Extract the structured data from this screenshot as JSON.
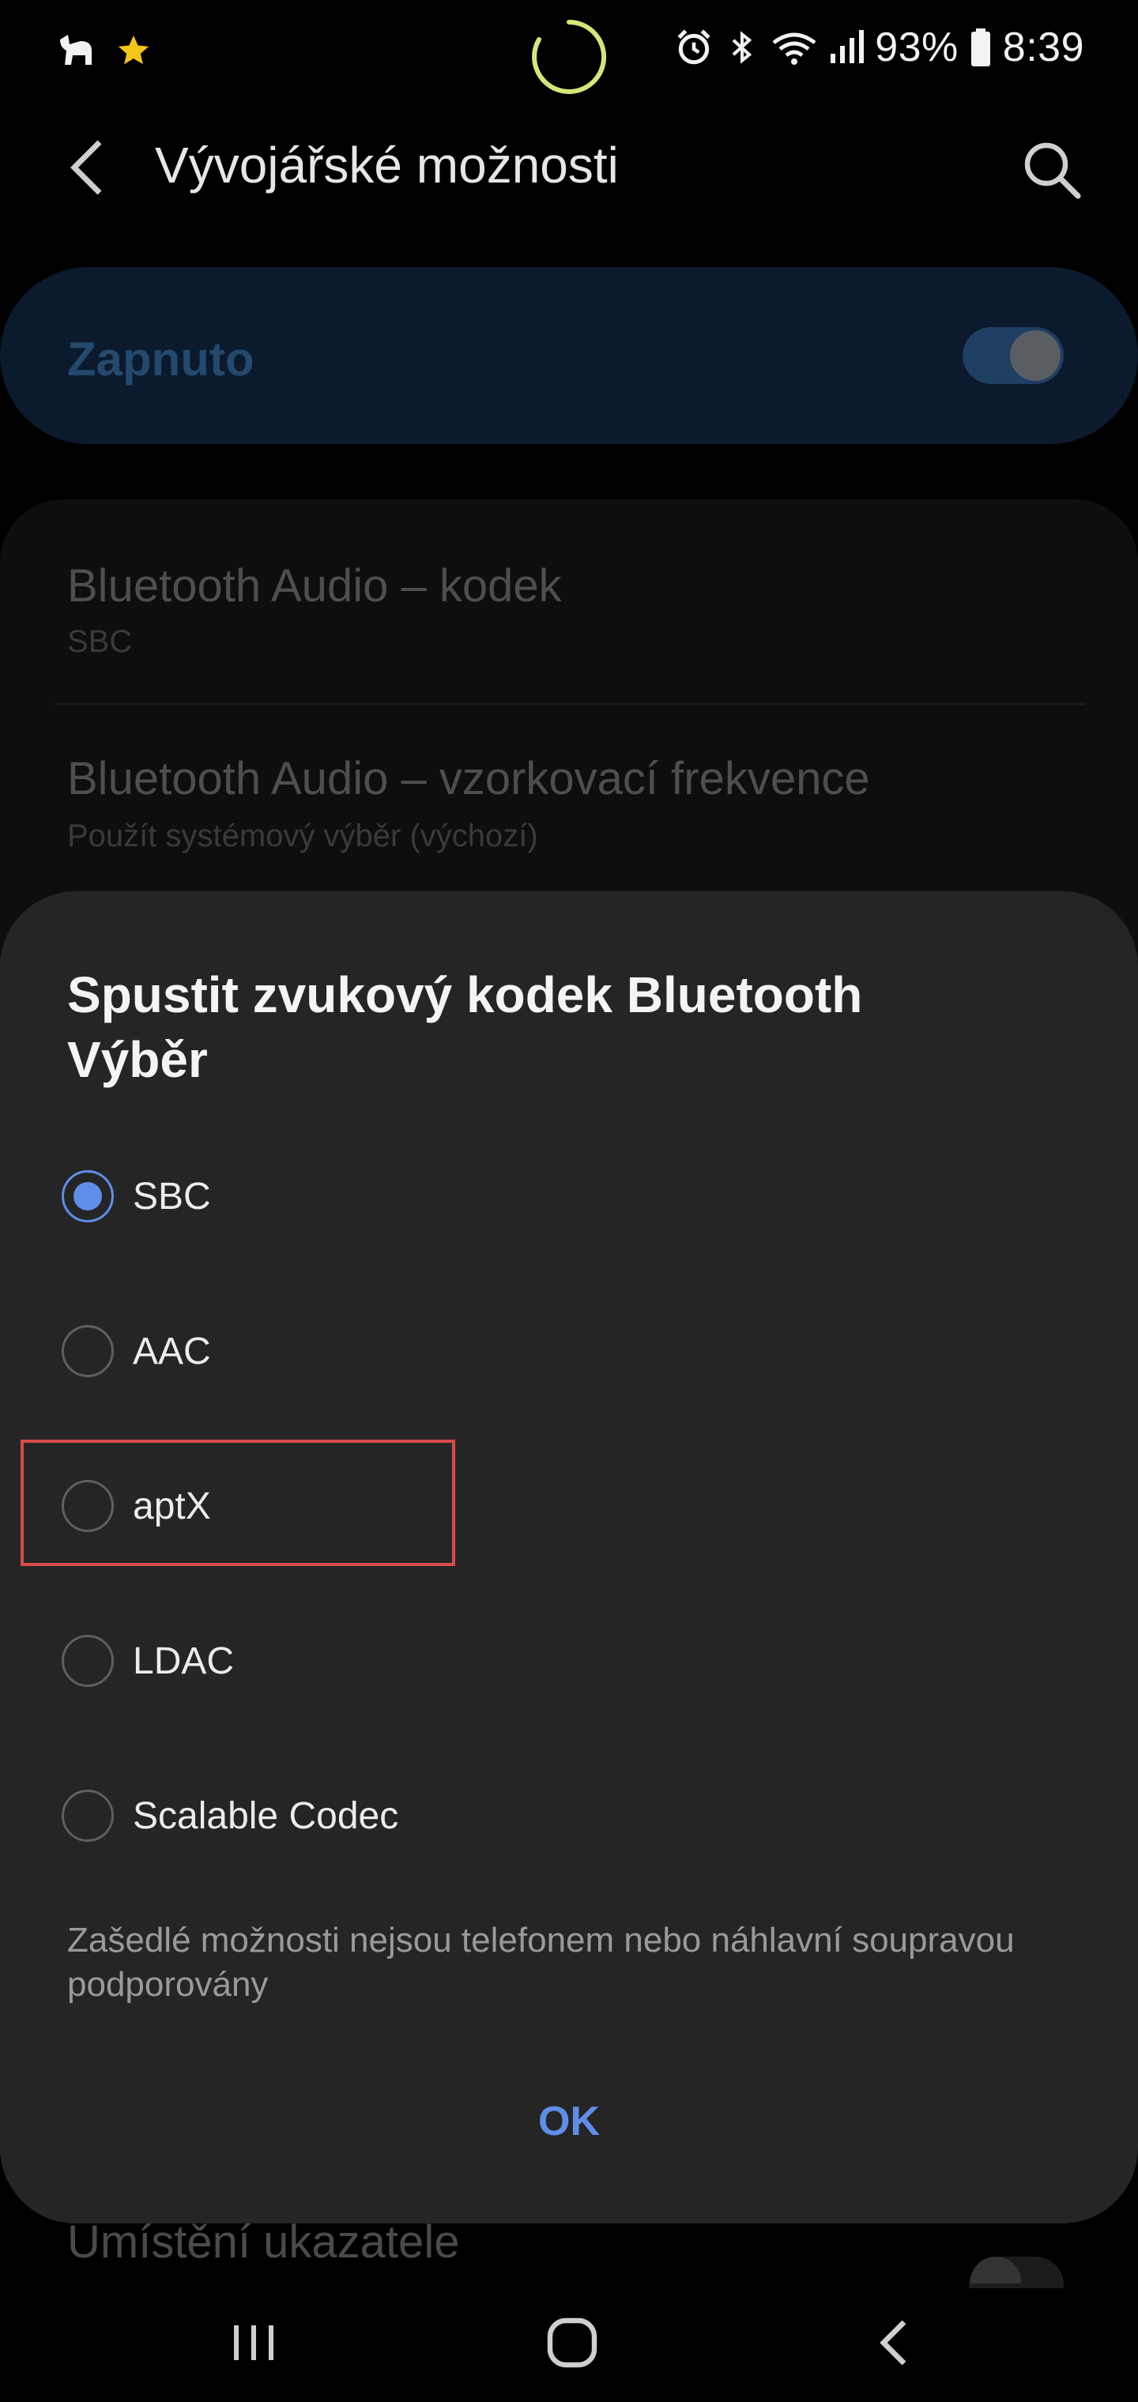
{
  "status_bar": {
    "battery": "93%",
    "time": "8:39",
    "left_icons": [
      "app-notification-icon",
      "star-icon"
    ],
    "right_icons": [
      "alarm-icon",
      "bluetooth-icon",
      "wifi-icon",
      "signal-icon",
      "battery-icon"
    ]
  },
  "app_bar": {
    "title": "Vývojářské možnosti",
    "back_icon": "back-arrow-icon",
    "search_icon": "search-icon"
  },
  "master_switch": {
    "label": "Zapnuto",
    "enabled": true
  },
  "background_settings": [
    {
      "title": "Bluetooth Audio – kodek",
      "subtitle": "SBC"
    },
    {
      "title": "Bluetooth Audio – vzorkovací frekvence",
      "subtitle": "Použít systémový výběr (výchozí)"
    }
  ],
  "background_bottom_label": "Umístění ukazatele",
  "dialog": {
    "title": "Spustit zvukový kodek Bluetooth Výběr",
    "options": [
      {
        "label": "SBC",
        "selected": true
      },
      {
        "label": "AAC",
        "selected": false
      },
      {
        "label": "aptX",
        "selected": false,
        "highlighted": true
      },
      {
        "label": "LDAC",
        "selected": false
      },
      {
        "label": "Scalable Codec",
        "selected": false
      }
    ],
    "note": "Zašedlé možnosti nejsou telefonem nebo náhlavní soupravou podporovány",
    "ok_label": "OK"
  },
  "colors": {
    "accent": "#5f8ee8",
    "highlight": "#d94b4b",
    "dialog_bg": "#252525",
    "loading_ring": "#d7e67a"
  },
  "nav_bar": {
    "buttons": [
      "recents-icon",
      "home-icon",
      "back-icon"
    ]
  }
}
